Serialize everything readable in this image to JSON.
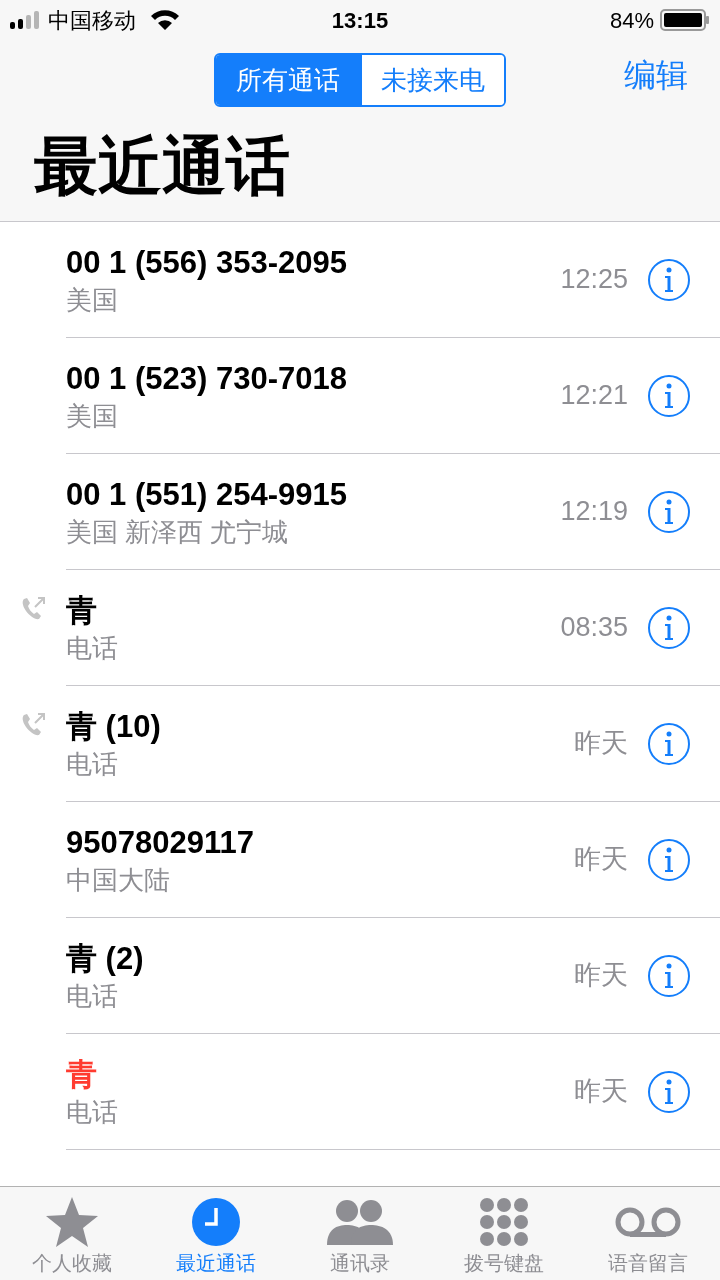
{
  "status_bar": {
    "carrier": "中国移动",
    "time": "13:15",
    "battery": "84%"
  },
  "segments": [
    {
      "label": "所有通话",
      "selected": true
    },
    {
      "label": "未接来电",
      "selected": false
    }
  ],
  "edit_button": "编辑",
  "title": "最近通话",
  "calls": [
    {
      "name": "00 1 (556) 353-2095",
      "detail": "美国",
      "time": "12:25",
      "outgoing": false,
      "missed": false
    },
    {
      "name": "00 1 (523) 730-7018",
      "detail": "美国",
      "time": "12:21",
      "outgoing": false,
      "missed": false
    },
    {
      "name": "00 1 (551) 254-9915",
      "detail": "美国 新泽西 尤宁城",
      "time": "12:19",
      "outgoing": false,
      "missed": false
    },
    {
      "name": "青",
      "detail": "电话",
      "time": "08:35",
      "outgoing": true,
      "missed": false
    },
    {
      "name": "青 (10)",
      "detail": "电话",
      "time": "昨天",
      "outgoing": true,
      "missed": false
    },
    {
      "name": "95078029117",
      "detail": "中国大陆",
      "time": "昨天",
      "outgoing": false,
      "missed": false
    },
    {
      "name": "青 (2)",
      "detail": "电话",
      "time": "昨天",
      "outgoing": false,
      "missed": false
    },
    {
      "name": "青",
      "detail": "电话",
      "time": "昨天",
      "outgoing": false,
      "missed": true
    }
  ],
  "tab_bar": [
    {
      "label": "个人收藏",
      "kind": "star",
      "selected": false
    },
    {
      "label": "最近通话",
      "kind": "clock",
      "selected": true
    },
    {
      "label": "通讯录",
      "kind": "people",
      "selected": false
    },
    {
      "label": "拨号键盘",
      "kind": "keypad",
      "selected": false
    },
    {
      "label": "语音留言",
      "kind": "voicemail",
      "selected": false
    }
  ]
}
